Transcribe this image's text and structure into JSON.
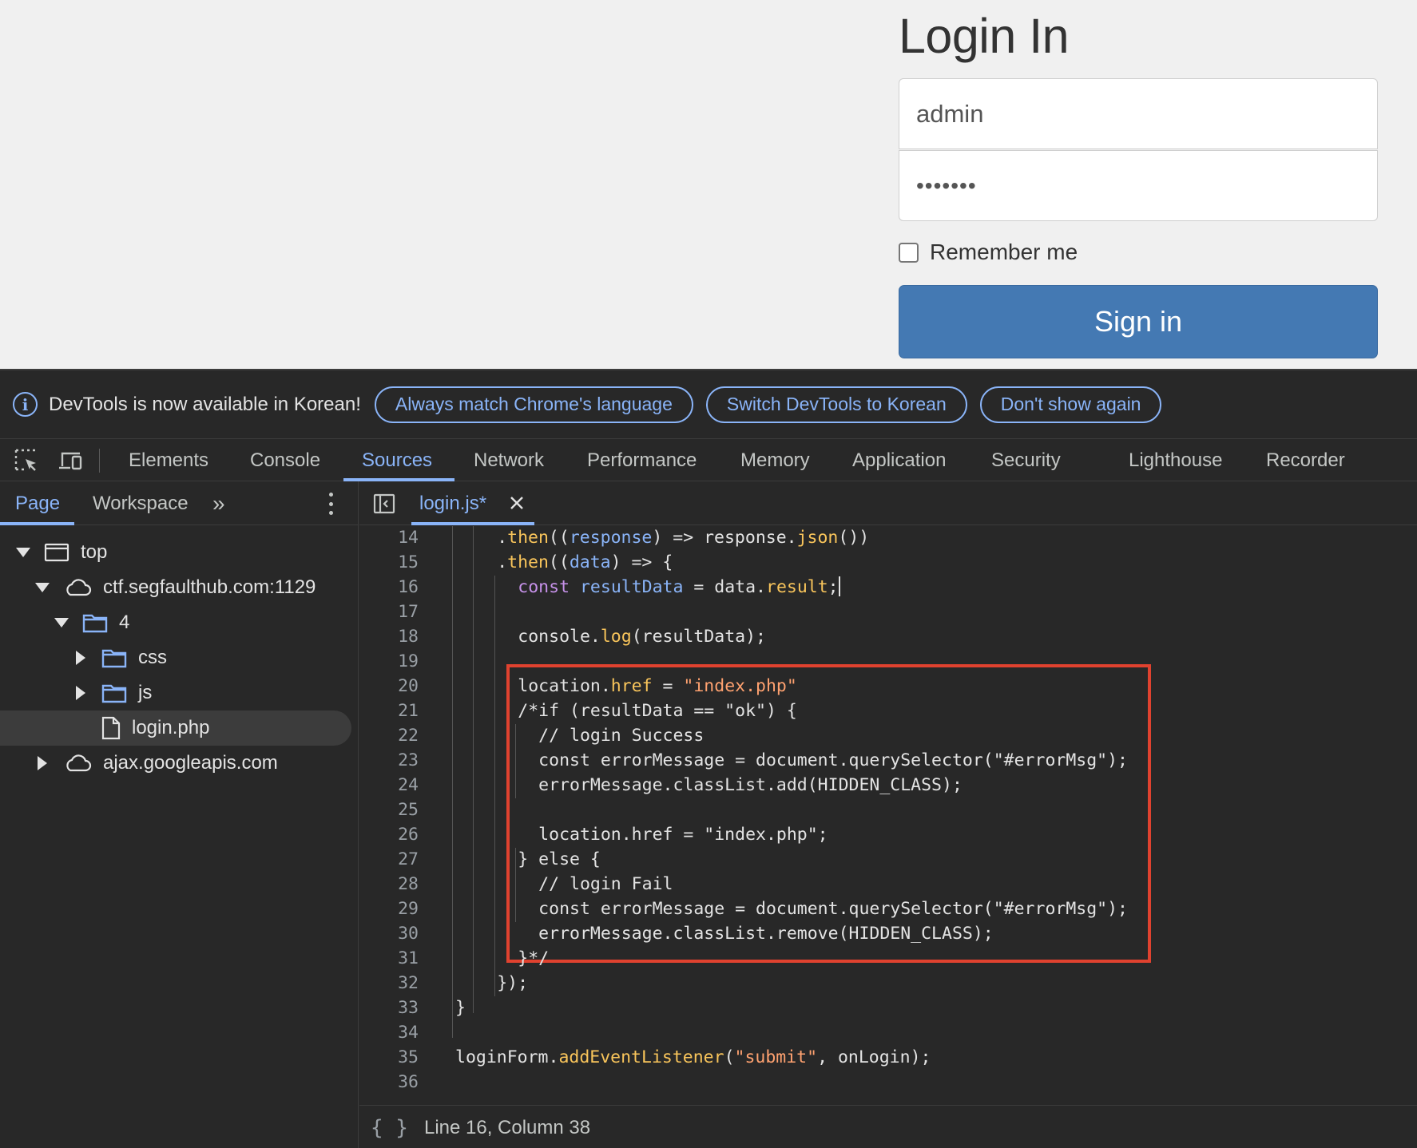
{
  "login": {
    "title": "Login In",
    "username_value": "admin",
    "password_value": "•••••••",
    "remember_label": "Remember me",
    "signin_label": "Sign in"
  },
  "infobar": {
    "message": "DevTools is now available in Korean!",
    "buttons": [
      "Always match Chrome's language",
      "Switch DevTools to Korean",
      "Don't show again"
    ]
  },
  "tabs": [
    "Elements",
    "Console",
    "Sources",
    "Network",
    "Performance",
    "Memory",
    "Application",
    "Security",
    "Lighthouse",
    "Recorder"
  ],
  "active_tab": "Sources",
  "sidebar": {
    "tabs": [
      "Page",
      "Workspace"
    ],
    "more": "»",
    "tree": [
      "top",
      "ctf.segfaulthub.com:1129",
      "4",
      "css",
      "js",
      "login.php",
      "ajax.googleapis.com"
    ],
    "selected": "login.php"
  },
  "editor": {
    "file_tab": "login.js*",
    "line_numbers": [
      "14",
      "15",
      "16",
      "17",
      "18",
      "19",
      "20",
      "21",
      "22",
      "23",
      "24",
      "25",
      "26",
      "27",
      "28",
      "29",
      "30",
      "31",
      "32",
      "33",
      "34",
      "35",
      "36"
    ],
    "lines": [
      [
        {
          "t": "."
        },
        {
          "t": "then",
          "c": "fn"
        },
        {
          "t": "(("
        },
        {
          "t": "response",
          "c": "var"
        },
        {
          "t": ") => response."
        },
        {
          "t": "json",
          "c": "fn"
        },
        {
          "t": "())"
        }
      ],
      [
        {
          "t": "."
        },
        {
          "t": "then",
          "c": "fn"
        },
        {
          "t": "(("
        },
        {
          "t": "data",
          "c": "var"
        },
        {
          "t": ") => {"
        }
      ],
      [
        {
          "t": "const",
          "c": "kw"
        },
        {
          "t": " "
        },
        {
          "t": "resultData",
          "c": "var"
        },
        {
          "t": " = data."
        },
        {
          "t": "result",
          "c": "fn"
        },
        {
          "t": ";"
        }
      ],
      [],
      [
        {
          "t": "console."
        },
        {
          "t": "log",
          "c": "fn"
        },
        {
          "t": "(resultData);"
        }
      ],
      [],
      [
        {
          "t": "location."
        },
        {
          "t": "href",
          "c": "fn"
        },
        {
          "t": " = "
        },
        {
          "t": "\"index.php\"",
          "c": "str"
        }
      ],
      [
        {
          "t": "/*if (resultData == \"ok\") {"
        }
      ],
      [
        {
          "t": "  // login Success"
        }
      ],
      [
        {
          "t": "  const errorMessage = document.querySelector(\"#errorMsg\");"
        }
      ],
      [
        {
          "t": "  errorMessage.classList.add(HIDDEN_CLASS);"
        }
      ],
      [],
      [
        {
          "t": "  location.href = \"index.php\";"
        }
      ],
      [
        {
          "t": "} else {"
        }
      ],
      [
        {
          "t": "  // login Fail"
        }
      ],
      [
        {
          "t": "  const errorMessage = document.querySelector(\"#errorMsg\");"
        }
      ],
      [
        {
          "t": "  errorMessage.classList.remove(HIDDEN_CLASS);"
        }
      ],
      [
        {
          "t": "}*/"
        }
      ],
      [
        {
          "t": "});"
        }
      ],
      [
        {
          "t": "}"
        }
      ],
      [],
      [
        {
          "t": "loginForm."
        },
        {
          "t": "addEventListener",
          "c": "fn"
        },
        {
          "t": "("
        },
        {
          "t": "\"submit\"",
          "c": "str"
        },
        {
          "t": ", onLogin);"
        }
      ],
      []
    ],
    "status": "Line 16, Column 38"
  },
  "colors": {
    "accent": "#8ab4f8",
    "highlight_border": "#e0422f",
    "signin_button": "#4479b3"
  }
}
